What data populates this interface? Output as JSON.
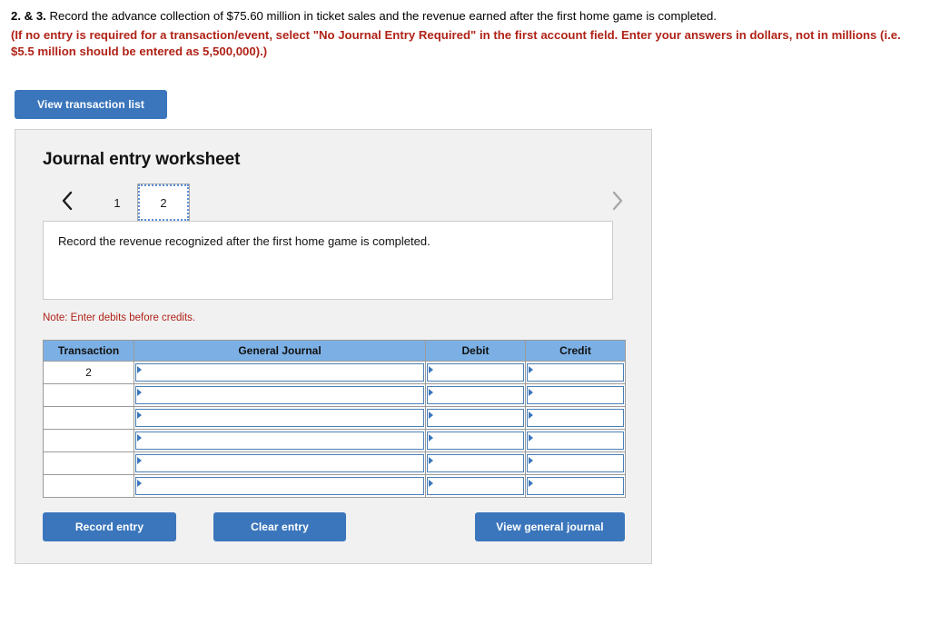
{
  "prompt": {
    "lead": "2. & 3.",
    "main": " Record the advance collection of $75.60 million in ticket sales and the revenue earned after the first home game is completed.",
    "note": "(If no entry is required for a transaction/event, select \"No Journal Entry Required\" in the first account field. Enter your answers in dollars, not in millions (i.e. $5.5 million should be entered as 5,500,000).)"
  },
  "toolbar": {
    "view_transaction_list_label": "View transaction list"
  },
  "worksheet": {
    "title": "Journal entry worksheet",
    "pager": {
      "prev_icon": "chevron-left-icon",
      "next_icon": "chevron-right-icon",
      "tabs": [
        {
          "label": "1",
          "selected": false
        },
        {
          "label": "2",
          "selected": true
        }
      ]
    },
    "instruction": "Record the revenue recognized after the first home game is completed.",
    "note": "Note: Enter debits before credits.",
    "table": {
      "headers": [
        "Transaction",
        "General Journal",
        "Debit",
        "Credit"
      ],
      "rows": [
        {
          "transaction": "2",
          "general_journal": "",
          "debit": "",
          "credit": ""
        },
        {
          "transaction": "",
          "general_journal": "",
          "debit": "",
          "credit": ""
        },
        {
          "transaction": "",
          "general_journal": "",
          "debit": "",
          "credit": ""
        },
        {
          "transaction": "",
          "general_journal": "",
          "debit": "",
          "credit": ""
        },
        {
          "transaction": "",
          "general_journal": "",
          "debit": "",
          "credit": ""
        },
        {
          "transaction": "",
          "general_journal": "",
          "debit": "",
          "credit": ""
        }
      ]
    },
    "buttons": {
      "record_entry": "Record entry",
      "clear_entry": "Clear entry",
      "view_general_journal": "View general journal"
    }
  },
  "colors": {
    "accent_blue": "#3B76BC",
    "header_blue": "#7CB0E5",
    "alert_red": "#B02318",
    "panel_gray": "#f1f1f1"
  }
}
